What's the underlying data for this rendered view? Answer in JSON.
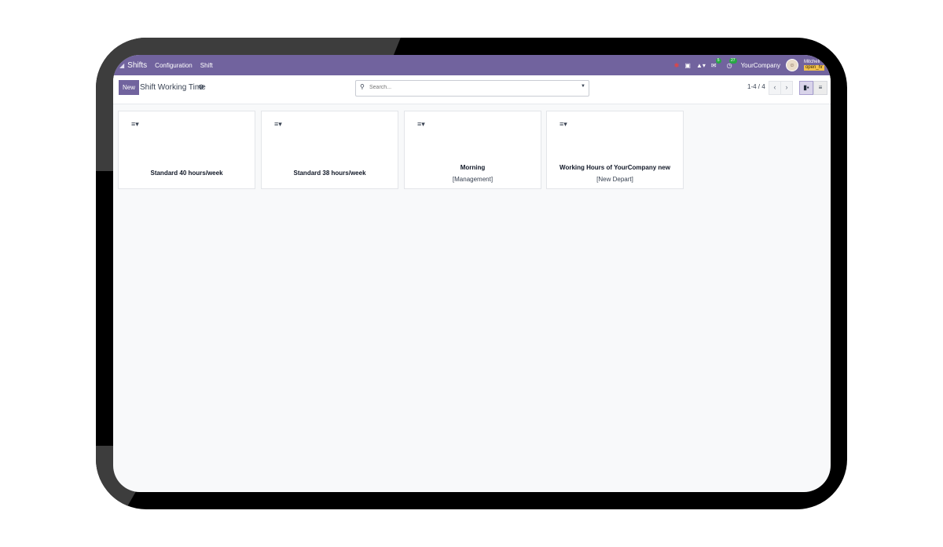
{
  "navbar": {
    "app_icon": "grid-icon",
    "app_name": "Shifts",
    "menu": [
      "Configuration",
      "Shift"
    ],
    "icons": [
      "bug-icon",
      "gift-icon",
      "bell-icon",
      "chat-icon",
      "activity-icon"
    ],
    "chat_count": "5",
    "activity_count": "27",
    "company": "YourCompany",
    "user_name": "Mitchell",
    "db_name": "open_hr"
  },
  "control": {
    "new_label": "New",
    "title": "Shift Working Time",
    "search_placeholder": "Search...",
    "pager": "1-4 / 4",
    "prev": "‹",
    "next": "›"
  },
  "cards": [
    {
      "title": "Standard 40 hours/week",
      "sub": ""
    },
    {
      "title": "Standard 38 hours/week",
      "sub": ""
    },
    {
      "title": "Morning",
      "sub": "[Management]"
    },
    {
      "title": "Working Hours of YourCompany new",
      "sub": "[New Depart]"
    }
  ],
  "colors": {
    "brand": "#71639e",
    "background": "#f8f9fa"
  }
}
